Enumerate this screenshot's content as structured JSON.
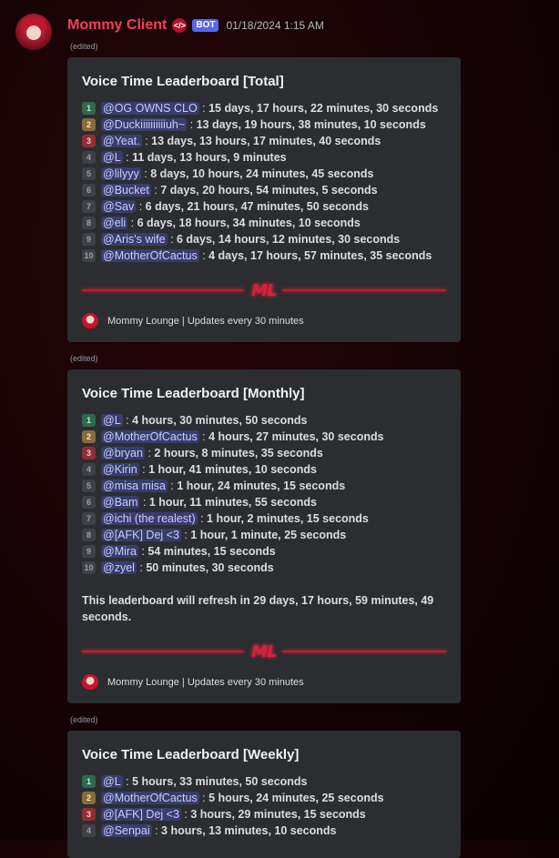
{
  "author": {
    "name": "Mommy Client",
    "bot_badge": "BOT",
    "timestamp": "01/18/2024 1:15 AM"
  },
  "edited_label": "(edited)",
  "footer_text": "Mommy Lounge | Updates every 30 minutes",
  "banner_logo": "ML",
  "embeds": [
    {
      "title": "Voice Time Leaderboard [Total]",
      "rows": [
        {
          "rank": "1",
          "user": "@OG OWNS CLO",
          "time": "15 days, 17 hours, 22 minutes, 30 seconds"
        },
        {
          "rank": "2",
          "user": "@Duckiiiiiiiiiiuh~",
          "time": "13 days, 19 hours, 38 minutes, 10 seconds"
        },
        {
          "rank": "3",
          "user": "@Yeat.",
          "time": "13 days, 13 hours, 17 minutes, 40 seconds"
        },
        {
          "rank": "4",
          "user": "@L",
          "time": "11 days, 13 hours, 9 minutes"
        },
        {
          "rank": "5",
          "user": "@lilyyy",
          "time": "8 days, 10 hours, 24 minutes, 45 seconds"
        },
        {
          "rank": "6",
          "user": "@Bucket",
          "time": "7 days, 20 hours, 54 minutes, 5 seconds"
        },
        {
          "rank": "7",
          "user": "@Sav",
          "time": "6 days, 21 hours, 47 minutes, 50 seconds"
        },
        {
          "rank": "8",
          "user": "@eli",
          "time": "6 days, 18 hours, 34 minutes, 10 seconds"
        },
        {
          "rank": "9",
          "user": "@Aris's wife",
          "time": "6 days, 14 hours, 12 minutes, 30 seconds"
        },
        {
          "rank": "10",
          "user": "@MotherOfCactus",
          "time": "4 days, 17 hours, 57 minutes, 35 seconds"
        }
      ]
    },
    {
      "title": "Voice Time Leaderboard [Monthly]",
      "rows": [
        {
          "rank": "1",
          "user": "@L",
          "time": "4 hours, 30 minutes, 50 seconds"
        },
        {
          "rank": "2",
          "user": "@MotherOfCactus",
          "time": "4 hours, 27 minutes, 30 seconds"
        },
        {
          "rank": "3",
          "user": "@bryan",
          "time": "2 hours, 8 minutes, 35 seconds"
        },
        {
          "rank": "4",
          "user": "@Kirin",
          "time": "1 hour, 41 minutes, 10 seconds"
        },
        {
          "rank": "5",
          "user": "@misa misa",
          "time": "1 hour, 24 minutes, 15 seconds"
        },
        {
          "rank": "6",
          "user": "@Bam",
          "time": "1 hour, 11 minutes, 55 seconds"
        },
        {
          "rank": "7",
          "user": "@ichi (the realest)",
          "time": "1 hour, 2 minutes, 15 seconds"
        },
        {
          "rank": "8",
          "user": "@[AFK] Dej <3",
          "time": "1 hour, 1 minute, 25 seconds"
        },
        {
          "rank": "9",
          "user": "@Mira",
          "time": "54 minutes, 15 seconds"
        },
        {
          "rank": "10",
          "user": "@zyel",
          "time": "50 minutes, 30 seconds"
        }
      ],
      "refresh_note": "This leaderboard will refresh in 29 days, 17 hours, 59 minutes, 49 seconds."
    },
    {
      "title": "Voice Time Leaderboard [Weekly]",
      "rows": [
        {
          "rank": "1",
          "user": "@L",
          "time": "5 hours, 33 minutes, 50 seconds"
        },
        {
          "rank": "2",
          "user": "@MotherOfCactus",
          "time": "5 hours, 24 minutes, 25 seconds"
        },
        {
          "rank": "3",
          "user": "@[AFK] Dej <3",
          "time": "3 hours, 29 minutes, 15 seconds"
        },
        {
          "rank": "4",
          "user": "@Senpai",
          "time": "3 hours, 13 minutes, 10 seconds"
        }
      ]
    }
  ],
  "colors": {
    "username": "#f04158",
    "bot_badge": "#5865f2",
    "embed_bg": "#2b2d31",
    "accent_red": "#c4162e"
  }
}
